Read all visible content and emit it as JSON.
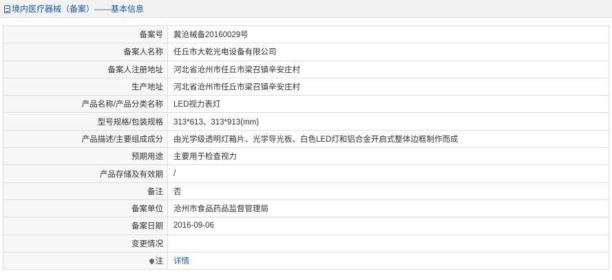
{
  "header": {
    "title": "境内医疗器械（备案）",
    "subtitle": "——基本信息"
  },
  "rows": [
    {
      "label": "备案号",
      "value": "冀沧械备20160029号"
    },
    {
      "label": "备案人名称",
      "value": "任丘市大乾光电设备有限公司"
    },
    {
      "label": "备案人注册地址",
      "value": "河北省沧州市任丘市梁召镇辛安庄村"
    },
    {
      "label": "生产地址",
      "value": "河北省沧州市任丘市梁召镇辛安庄村"
    },
    {
      "label": "产品名称/产品分类名称",
      "value": "LED视力表灯"
    },
    {
      "label": "型号规格/包装规格",
      "value": "313*613、313*913(mm)"
    },
    {
      "label": "产品描述/主要组成成分",
      "value": "由光学级透明灯箱片、光学导光板、白色LED灯和铝合金开启式整体边框制作而成"
    },
    {
      "label": "预期用途",
      "value": "主要用于检查视力"
    },
    {
      "label": "产品存储及有效期",
      "value": "/"
    },
    {
      "label": "备注",
      "value": "否"
    },
    {
      "label": "备案单位",
      "value": "沧州市食品药品监督管理局"
    },
    {
      "label": "备案日期",
      "value": "2016-09-06"
    },
    {
      "label": "变更情况",
      "value": ""
    }
  ],
  "note_row": {
    "label": "注",
    "icon": "pin-icon",
    "link_text": "详情"
  },
  "colors": {
    "link": "#1a5aa6",
    "label_bg": "#f7f7f7",
    "border": "#dcdcdc"
  }
}
